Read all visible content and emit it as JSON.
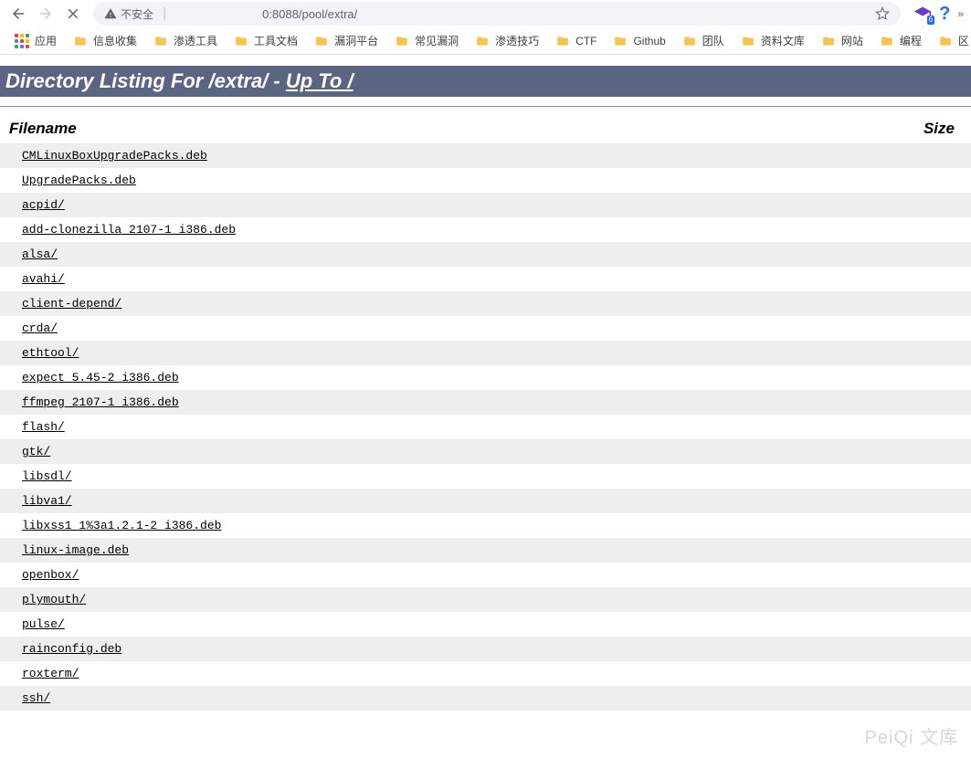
{
  "browser": {
    "insecure_label": "不安全",
    "url_port_path": "0:8088/pool/extra/",
    "ext_badge": "6",
    "help_label": "?"
  },
  "bookmarks": {
    "apps_label": "应用",
    "items": [
      "信息收集",
      "渗透工具",
      "工具文档",
      "漏洞平台",
      "常见漏洞",
      "渗透技巧",
      "CTF",
      "Github",
      "团队",
      "资料文库",
      "网站",
      "编程",
      "区"
    ]
  },
  "page": {
    "title_prefix": "Directory Listing For /extra/ - ",
    "title_link": "Up To /",
    "col_filename": "Filename",
    "col_size": "Size",
    "files": [
      "CMLinuxBoxUpgradePacks.deb",
      "UpgradePacks.deb",
      "acpid/",
      "add-clonezilla 2107-1 i386.deb",
      "alsa/",
      "avahi/",
      "client-depend/",
      "crda/",
      "ethtool/",
      "expect 5.45-2 i386.deb",
      "ffmpeg 2107-1 i386.deb",
      "flash/",
      "gtk/",
      "libsdl/",
      "libva1/",
      "libxss1 1%3a1.2.1-2 i386.deb",
      "linux-image.deb",
      "openbox/",
      "plymouth/",
      "pulse/",
      "rainconfig.deb",
      "roxterm/",
      "ssh/"
    ]
  },
  "watermark": "PeiQi 文库"
}
